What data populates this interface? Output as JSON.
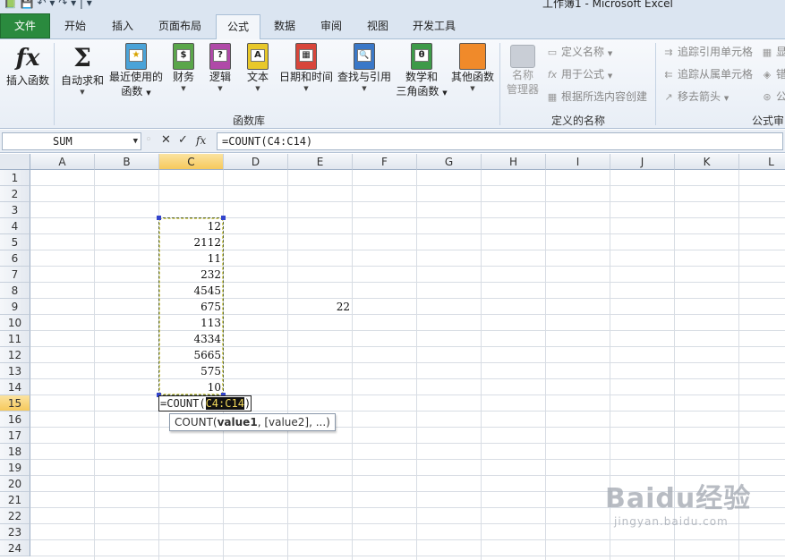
{
  "window": {
    "qat": "📗 💾 ↶ ▾ ↷ ▾ | ▾",
    "title": "工作簿1 - Microsoft Excel"
  },
  "tabs": [
    {
      "label": "文件",
      "kind": "file"
    },
    {
      "label": "开始"
    },
    {
      "label": "插入"
    },
    {
      "label": "页面布局"
    },
    {
      "label": "公式",
      "kind": "active"
    },
    {
      "label": "数据"
    },
    {
      "label": "审阅"
    },
    {
      "label": "视图"
    },
    {
      "label": "开发工具"
    }
  ],
  "ribbon": {
    "insert_function": {
      "icon": "fx",
      "label": "插入函数"
    },
    "autosum": {
      "icon": "Σ",
      "label": "自动求和"
    },
    "recent": {
      "label": "最近使用的",
      "label2": "函数"
    },
    "financial": {
      "label": "财务",
      "glyph": "$"
    },
    "logical": {
      "label": "逻辑",
      "glyph": "?"
    },
    "text": {
      "label": "文本",
      "glyph": "A"
    },
    "datetime": {
      "label": "日期和时间",
      "glyph": "▦"
    },
    "lookup": {
      "label": "查找与引用",
      "glyph": "🔍"
    },
    "math": {
      "label": "数学和",
      "label2": "三角函数",
      "glyph": "θ"
    },
    "more": {
      "label": "其他函数"
    },
    "group_function_library": "函数库",
    "name_manager": {
      "label": "名称",
      "label2": "管理器"
    },
    "define_name": "定义名称",
    "use_in_formula": "用于公式",
    "create_from_selection": "根据所选内容创建",
    "group_defined_names": "定义的名称",
    "trace_precedents": "追踪引用单元格",
    "trace_dependents": "追踪从属单元格",
    "remove_arrows": "移去箭头",
    "show_formulas_cut": "显",
    "error_check_cut": "错",
    "evaluate_cut": "公",
    "group_formula_auditing": "公式审"
  },
  "formula_bar": {
    "name_box": "SUM",
    "cancel_glyph": "✕",
    "enter_glyph": "✓",
    "fx_glyph": "fx",
    "formula": "=COUNT(C4:C14)"
  },
  "grid": {
    "columns": [
      "A",
      "B",
      "C",
      "D",
      "E",
      "F",
      "G",
      "H",
      "I",
      "J",
      "K",
      "L"
    ],
    "rows": [
      "1",
      "2",
      "3",
      "4",
      "5",
      "6",
      "7",
      "8",
      "9",
      "10",
      "11",
      "12",
      "13",
      "14",
      "15",
      "16",
      "17",
      "18",
      "19",
      "20",
      "21",
      "22",
      "23",
      "24"
    ],
    "selected_column": "C",
    "selected_row": "15",
    "column_c_values": [
      "12",
      "2112",
      "11",
      "232",
      "4545",
      "675",
      "113",
      "4334",
      "5665",
      "575",
      "10"
    ],
    "e9_value": "22",
    "edit_prefix": "=COUNT(",
    "edit_ref": "C4:C14",
    "edit_suffix": ")"
  },
  "tooltip": {
    "func": "COUNT(",
    "arg1": "value1",
    "rest": ", [value2], ...)"
  },
  "watermark": {
    "big": "Baidu经验",
    "small": "jingyan.baidu.com"
  },
  "colors": {
    "file_tab": "#2a8a3e",
    "selected_header": "#f6c95c",
    "ref_highlight": "#f2d85a"
  }
}
